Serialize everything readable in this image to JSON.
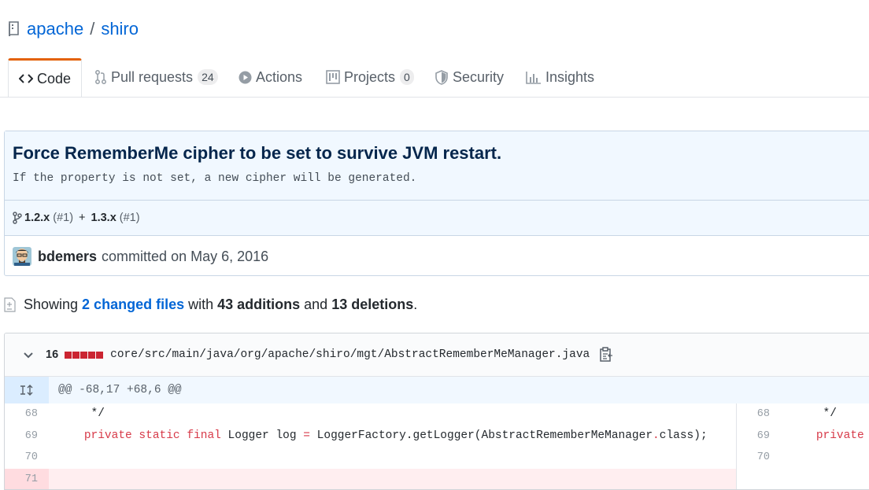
{
  "repo": {
    "owner": "apache",
    "separator": "/",
    "name": "shiro"
  },
  "tabs": [
    {
      "label": "Code",
      "icon": "code-icon",
      "selected": true
    },
    {
      "label": "Pull requests",
      "icon": "pull-request-icon",
      "count": "24"
    },
    {
      "label": "Actions",
      "icon": "play-icon"
    },
    {
      "label": "Projects",
      "icon": "project-icon",
      "count": "0"
    },
    {
      "label": "Security",
      "icon": "shield-icon"
    },
    {
      "label": "Insights",
      "icon": "graph-icon"
    }
  ],
  "commit": {
    "title": "Force RememberMe cipher to be set to survive JVM restart.",
    "description": "If the property is not set, a new cipher will be generated.",
    "branches": [
      {
        "name": "1.2.x",
        "pr": "(#1)"
      },
      {
        "name": "1.3.x",
        "pr": "(#1)"
      }
    ],
    "branch_join": "+",
    "author": "bdemers",
    "committed_text": "committed on May 6, 2016"
  },
  "toc": {
    "prefix": "Showing",
    "changed_files": "2 changed files",
    "with": "with",
    "additions": "43 additions",
    "and": "and",
    "deletions": "13 deletions",
    "suffix": "."
  },
  "file": {
    "change_count": "16",
    "diffstat": [
      "#cb2431",
      "#cb2431",
      "#cb2431",
      "#cb2431",
      "#cb2431",
      "#d1d5da"
    ],
    "path": "core/src/main/java/org/apache/shiro/mgt/AbstractRememberMeManager.java",
    "hunk_header": "@@ -68,17 +68,6 @@",
    "lines": [
      {
        "left_num": "68",
        "right_num": "68",
        "left_code": "     */",
        "right_code": "     */"
      },
      {
        "left_num": "69",
        "right_num": "69",
        "left_pre": "    ",
        "left_kw": "private static final",
        "left_rest": " Logger log ",
        "left_eq": "=",
        "left_tail": " LoggerFactory.getLogger(AbstractRememberMeManager",
        "left_dot": ".",
        "left_end": "class);",
        "right_pre": "    ",
        "right_kw": "private"
      },
      {
        "left_num": "70",
        "right_num": "70",
        "left_code": "",
        "right_code": ""
      },
      {
        "left_num": "71",
        "right_num": "",
        "left_code": "",
        "right_code": ""
      }
    ]
  },
  "colors": {
    "link": "#0366d6",
    "tab_accent": "#e36209",
    "commit_bg": "#f1f8ff",
    "deletion": "#cb2431"
  }
}
